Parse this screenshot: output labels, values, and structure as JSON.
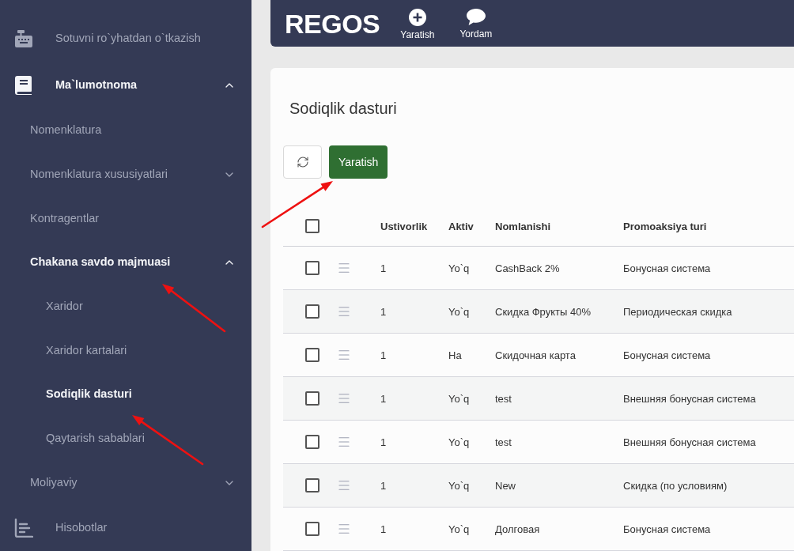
{
  "sidebar": {
    "items": [
      {
        "label": "Sotuvni ro`yhatdan o`tkazish",
        "selected": false
      },
      {
        "label": "Ma`lumotnoma",
        "expanded": true,
        "children": [
          {
            "label": "Nomenklatura",
            "selected": false
          },
          {
            "label": "Nomenklatura xususiyatlari",
            "expanded": false
          },
          {
            "label": "Kontragentlar",
            "selected": false
          },
          {
            "label": "Chakana savdo majmuasi",
            "expanded": true,
            "children": [
              {
                "label": "Xaridor",
                "selected": false
              },
              {
                "label": "Xaridor kartalari",
                "selected": false
              },
              {
                "label": "Sodiqlik dasturi",
                "selected": true
              },
              {
                "label": "Qaytarish sabablari",
                "selected": false
              }
            ]
          },
          {
            "label": "Moliyaviy",
            "expanded": false
          }
        ]
      },
      {
        "label": "Hisobotlar",
        "selected": false
      }
    ]
  },
  "header": {
    "logo": "REGOS",
    "actions": [
      {
        "label": "Yaratish"
      },
      {
        "label": "Yordam"
      }
    ]
  },
  "page": {
    "title": "Sodiqlik dasturi",
    "create_button": "Yaratish"
  },
  "table": {
    "select_all": {
      "checked": false
    },
    "columns": [
      "Ustivorlik",
      "Aktiv",
      "Nomlanishi",
      "Promoaksiya turi"
    ],
    "rows": [
      {
        "checked": false,
        "cells": [
          "1",
          "Yo`q",
          "CashBack 2%",
          "Бонусная система"
        ]
      },
      {
        "checked": false,
        "cells": [
          "1",
          "Yo`q",
          "Скидка Фрукты 40%",
          "Периодическая скидка"
        ]
      },
      {
        "checked": false,
        "cells": [
          "1",
          "На",
          "Скидочная карта",
          "Бонусная система"
        ]
      },
      {
        "checked": false,
        "cells": [
          "1",
          "Yo`q",
          "test",
          "Внешняя бонусная система"
        ]
      },
      {
        "checked": false,
        "cells": [
          "1",
          "Yo`q",
          "test",
          "Внешняя бонусная система"
        ]
      },
      {
        "checked": false,
        "cells": [
          "1",
          "Yo`q",
          "New",
          "Скидка (по условиям)"
        ]
      },
      {
        "checked": false,
        "cells": [
          "1",
          "Yo`q",
          "Долговая",
          "Бонусная система"
        ]
      }
    ]
  }
}
